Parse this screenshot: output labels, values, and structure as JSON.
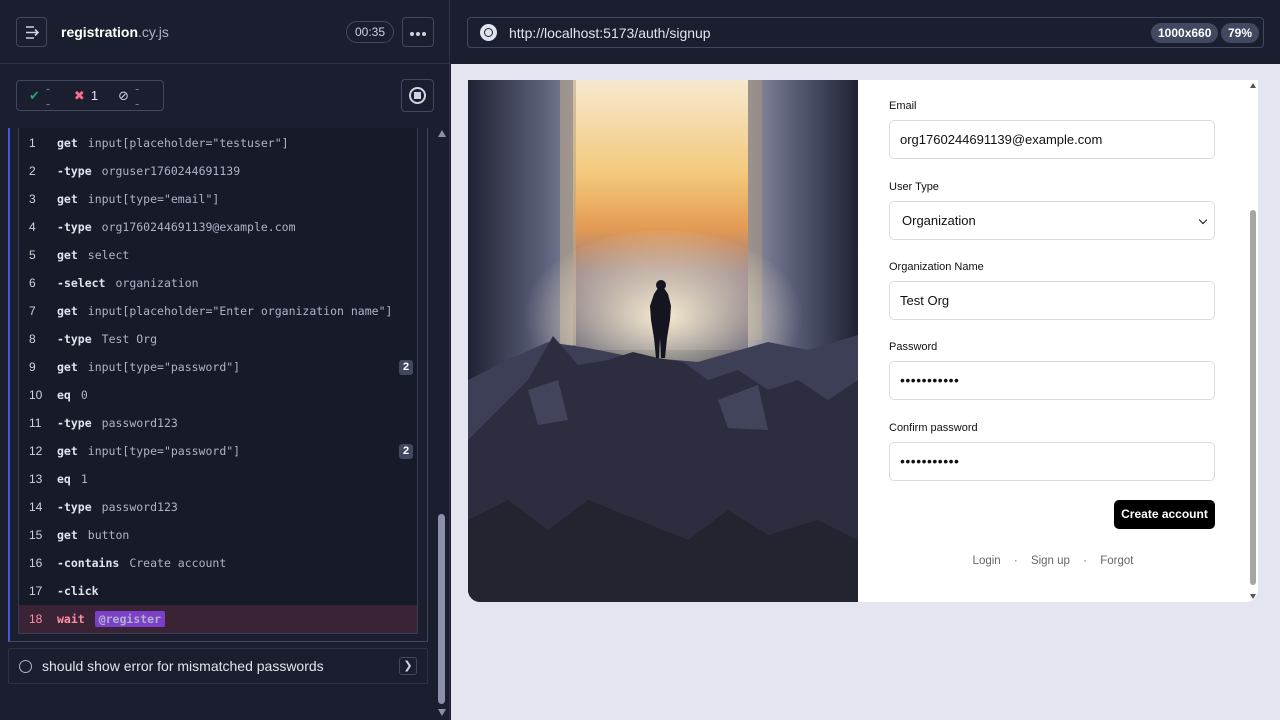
{
  "reporter": {
    "spec_name": "registration",
    "spec_ext": ".cy.js",
    "duration": "00:35",
    "stats": {
      "passed": "--",
      "failed": "1",
      "pending": "--"
    },
    "commands": [
      {
        "num": "1",
        "name": "get",
        "msg": "input[placeholder=\"testuser\"]",
        "child": false
      },
      {
        "num": "2",
        "name": "type",
        "msg": "orguser1760244691139",
        "child": true
      },
      {
        "num": "3",
        "name": "get",
        "msg": "input[type=\"email\"]",
        "child": false
      },
      {
        "num": "4",
        "name": "type",
        "msg": "org1760244691139@example.com",
        "child": true
      },
      {
        "num": "5",
        "name": "get",
        "msg": "select",
        "child": false
      },
      {
        "num": "6",
        "name": "select",
        "msg": "organization",
        "child": true
      },
      {
        "num": "7",
        "name": "get",
        "msg": "input[placeholder=\"Enter organization name\"]",
        "child": false
      },
      {
        "num": "8",
        "name": "type",
        "msg": "Test Org",
        "child": true
      },
      {
        "num": "9",
        "name": "get",
        "msg": "input[type=\"password\"]",
        "child": false,
        "badge": "2"
      },
      {
        "num": "10",
        "name": "eq",
        "msg": "0",
        "child": false
      },
      {
        "num": "11",
        "name": "type",
        "msg": "password123",
        "child": true
      },
      {
        "num": "12",
        "name": "get",
        "msg": "input[type=\"password\"]",
        "child": false,
        "badge": "2"
      },
      {
        "num": "13",
        "name": "eq",
        "msg": "1",
        "child": false
      },
      {
        "num": "14",
        "name": "type",
        "msg": "password123",
        "child": true
      },
      {
        "num": "15",
        "name": "get",
        "msg": "button",
        "child": false
      },
      {
        "num": "16",
        "name": "contains",
        "msg": "Create account",
        "child": true
      },
      {
        "num": "17",
        "name": "click",
        "msg": "",
        "child": true
      },
      {
        "num": "18",
        "name": "wait",
        "msg": "@register",
        "child": false,
        "active": true
      }
    ],
    "next_test": "should show error for mismatched passwords"
  },
  "aut": {
    "url": "http://localhost:5173/auth/signup",
    "viewport": "1000x660",
    "zoom": "79%",
    "form": {
      "email_label": "Email",
      "email_value": "org1760244691139@example.com",
      "user_type_label": "User Type",
      "user_type_value": "Organization",
      "org_name_label": "Organization Name",
      "org_name_value": "Test Org",
      "password_label": "Password",
      "password_value": "•••••••••••",
      "confirm_label": "Confirm password",
      "confirm_value": "•••••••••••",
      "create_button": "Create account",
      "link_login": "Login",
      "link_signup": "Sign up",
      "link_forgot": "Forgot",
      "separator": "·"
    }
  },
  "colors": {
    "failed": "#ff6b8a",
    "passed": "#1fa971",
    "active_row": "#3b2336",
    "alias_badge": "#7b3fc9"
  }
}
